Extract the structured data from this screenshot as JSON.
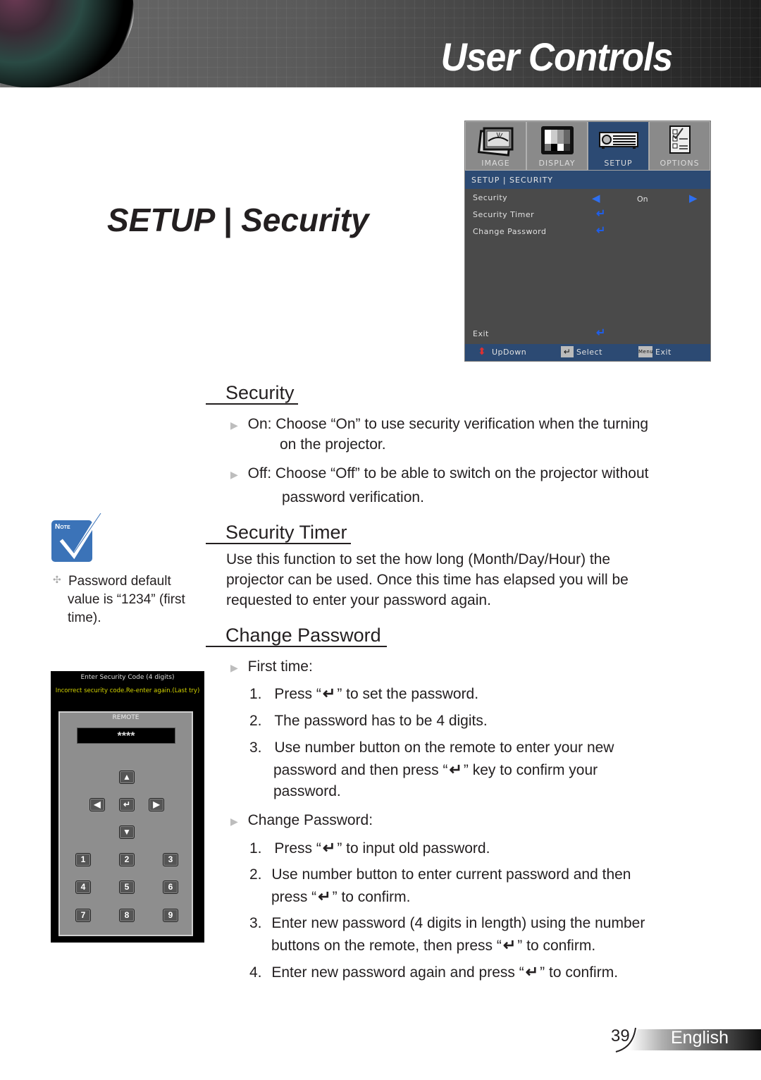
{
  "header": {
    "title": "User Controls"
  },
  "page_title": "SETUP | Security",
  "osd": {
    "tabs": [
      {
        "label": "IMAGE",
        "icon": "image-icon",
        "active": false
      },
      {
        "label": "DISPLAY",
        "icon": "display-icon",
        "active": false
      },
      {
        "label": "SETUP",
        "icon": "projector-icon",
        "active": true
      },
      {
        "label": "OPTIONS",
        "icon": "options-checklist-icon",
        "active": false
      }
    ],
    "breadcrumb": "SETUP | SECURITY",
    "rows": [
      {
        "label": "Security",
        "value": "On",
        "control": "left-right-arrows"
      },
      {
        "label": "Security Timer",
        "control": "enter"
      },
      {
        "label": "Change Password",
        "control": "enter"
      }
    ],
    "exit_label": "Exit",
    "footer": {
      "updown": "UpDown",
      "select": "Select",
      "menu_key": "Menu",
      "exit": "Exit"
    },
    "colors": {
      "active_tab": "#2c4a73",
      "panel": "#4a4a4a",
      "enter_icon": "#1f5ee8"
    }
  },
  "sections": {
    "security": {
      "heading": "Security",
      "items": [
        {
          "line1": "On: Choose “On” to use security verification when the turning",
          "line2": "on the projector."
        },
        {
          "line1": "Off: Choose “Off” to be able to switch on the projector without",
          "line2": "password verification."
        }
      ]
    },
    "timer": {
      "heading": "Security Timer",
      "lines": [
        "Use this function to set the how long (Month/Day/Hour) the",
        "projector can be used. Once this time has elapsed you will be",
        "requested to enter your password again."
      ]
    },
    "change": {
      "heading": "Change Password",
      "first_time_label": "First time:",
      "first_time_steps": [
        {
          "num": "1.",
          "pre": "Press “",
          "post": "” to set the password."
        },
        {
          "num": "2.",
          "text": "The password has to be 4 digits."
        },
        {
          "num": "3.",
          "line1": "Use number button on the remote to enter your new",
          "pre": "password and then press “",
          "post": "” key to confirm your",
          "line3": "password."
        }
      ],
      "change_label": "Change Password:",
      "change_steps": [
        {
          "num": "1.",
          "pre": "Press “",
          "post": "” to input old password."
        },
        {
          "num": "2.",
          "line1": "Use number button to enter current password and then",
          "pre": "press “",
          "post": "” to confirm."
        },
        {
          "num": "3.",
          "line1": "Enter new password (4 digits in length) using the number",
          "pre": "buttons on the remote, then press “",
          "post": "” to confirm."
        },
        {
          "num": "4.",
          "pre": "Enter new password again and press “",
          "post": "” to confirm."
        }
      ]
    }
  },
  "note": {
    "badge": "Note",
    "lines": [
      "Password default",
      "value is “1234” (first",
      "time)."
    ]
  },
  "remote_panel": {
    "prompt": "Enter Security Code (4 digits)",
    "error": "Incorrect security code.Re-enter again.(Last try)",
    "remote_label": "REMOTE",
    "code_display": "****",
    "digits": [
      "1",
      "2",
      "3",
      "4",
      "5",
      "6",
      "7",
      "8",
      "9"
    ],
    "colors": {
      "error_text": "#d4d400"
    }
  },
  "footer": {
    "page_number": "39",
    "language": "English"
  }
}
